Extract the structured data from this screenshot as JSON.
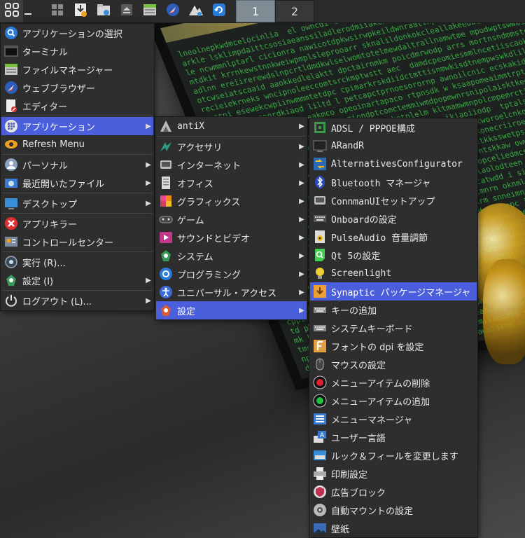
{
  "panel": {
    "workspaces": [
      "1",
      "2"
    ],
    "active_workspace": "1"
  },
  "main_menu": {
    "items": [
      {
        "label": "アプリケーションの選択",
        "icon": "app-finder-icon"
      },
      {
        "label": "ターミナル",
        "icon": "terminal-icon"
      },
      {
        "label": "ファイルマネージャー",
        "icon": "file-manager-icon"
      },
      {
        "label": "ウェブブラウザー",
        "icon": "web-browser-icon"
      },
      {
        "label": "エディター",
        "icon": "editor-icon"
      },
      {
        "label": "アプリケーション",
        "icon": "applications-icon",
        "submenu": true
      },
      {
        "label": "Refresh Menu",
        "icon": "refresh-menu-icon"
      },
      {
        "label": "パーソナル",
        "icon": "personal-icon",
        "submenu": true
      },
      {
        "label": "最近開いたファイル",
        "icon": "recent-files-icon",
        "submenu": true
      },
      {
        "label": "デスクトップ",
        "icon": "desktop-icon",
        "submenu": true
      },
      {
        "label": "アプリキラー",
        "icon": "app-killer-icon"
      },
      {
        "label": "コントロールセンター",
        "icon": "control-center-icon"
      },
      {
        "label": "実行 (R)...",
        "icon": "run-icon"
      },
      {
        "label": "設定 (I)",
        "icon": "settings-icon",
        "submenu": true
      },
      {
        "label": "ログアウト (L)...",
        "icon": "logout-icon",
        "submenu": true
      }
    ]
  },
  "apps_menu": {
    "items": [
      {
        "label": "antiX",
        "icon": "antix-icon"
      },
      {
        "label": "アクセサリ",
        "icon": "accessories-icon"
      },
      {
        "label": "インターネット",
        "icon": "internet-icon"
      },
      {
        "label": "オフィス",
        "icon": "office-icon"
      },
      {
        "label": "グラフィックス",
        "icon": "graphics-icon"
      },
      {
        "label": "ゲーム",
        "icon": "games-icon"
      },
      {
        "label": "サウンドとビデオ",
        "icon": "sound-video-icon"
      },
      {
        "label": "システム",
        "icon": "system-icon"
      },
      {
        "label": "プログラミング",
        "icon": "programming-icon"
      },
      {
        "label": "ユニバーサル・アクセス",
        "icon": "accessibility-icon"
      },
      {
        "label": "設定",
        "icon": "settings-category-icon"
      }
    ]
  },
  "settings_menu": {
    "items": [
      {
        "label": "ADSL / PPPOE構成",
        "icon": "adsl-icon"
      },
      {
        "label": "ARandR",
        "icon": "arandr-icon"
      },
      {
        "label": "AlternativesConfigurator",
        "icon": "alternatives-icon"
      },
      {
        "label": "Bluetooth マネージャ",
        "icon": "bluetooth-icon"
      },
      {
        "label": "ConnmanUIセットアップ",
        "icon": "connman-icon"
      },
      {
        "label": "Onboardの設定",
        "icon": "onboard-icon"
      },
      {
        "label": "PulseAudio 音量調節",
        "icon": "pulseaudio-icon"
      },
      {
        "label": "Qt 5の設定",
        "icon": "qt5-icon"
      },
      {
        "label": "Screenlight",
        "icon": "screenlight-icon"
      },
      {
        "label": "Synaptic パッケージマネージャ",
        "icon": "synaptic-icon"
      },
      {
        "label": "キーの追加",
        "icon": "keyboard-add-icon"
      },
      {
        "label": "システムキーボード",
        "icon": "system-keyboard-icon"
      },
      {
        "label": "フォントの dpi を設定",
        "icon": "font-dpi-icon"
      },
      {
        "label": "マウスの設定",
        "icon": "mouse-icon"
      },
      {
        "label": "メニューアイテムの削除",
        "icon": "menu-remove-icon"
      },
      {
        "label": "メニューアイテムの追加",
        "icon": "menu-add-icon"
      },
      {
        "label": "メニューマネージャ",
        "icon": "menu-manager-icon"
      },
      {
        "label": "ユーザー言語",
        "icon": "user-language-icon"
      },
      {
        "label": "ルック＆フィールを変更します",
        "icon": "look-feel-icon"
      },
      {
        "label": "印刷設定",
        "icon": "printer-icon"
      },
      {
        "label": "広告ブロック",
        "icon": "ad-block-icon"
      },
      {
        "label": "自動マウントの設定",
        "icon": "automount-icon"
      },
      {
        "label": "壁紙",
        "icon": "wallpaper-icon"
      }
    ]
  },
  "colors": {
    "highlight": "#4b5fdc",
    "menu_bg": "#2e2e2e",
    "panel_bg": "#2b2b2b"
  }
}
